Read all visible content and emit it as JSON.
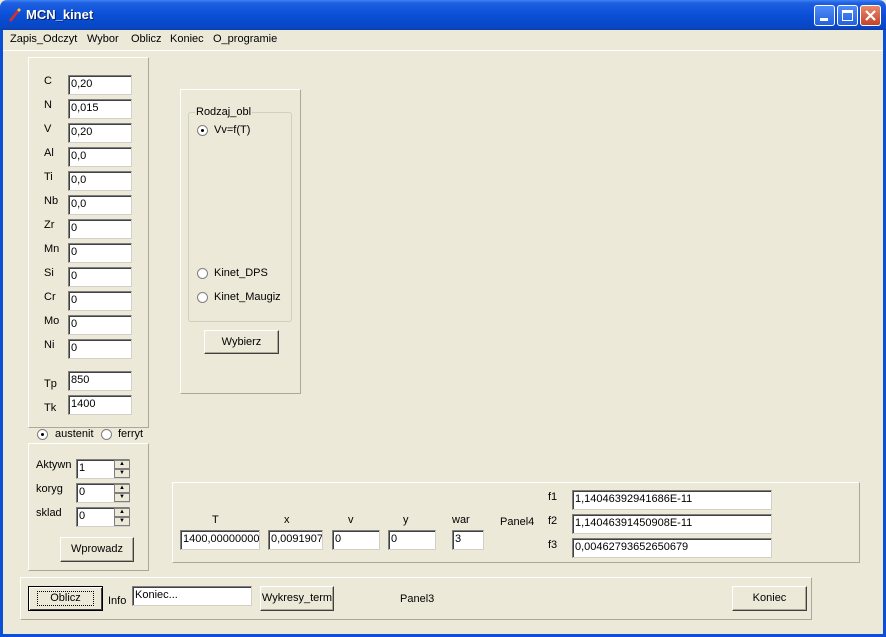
{
  "window": {
    "title": "MCN_kinet"
  },
  "menu": [
    "Zapis_Odczyt",
    "Wybor",
    "Oblicz",
    "Koniec",
    "O_programie"
  ],
  "composition": [
    {
      "label": "C",
      "value": "0,20"
    },
    {
      "label": "N",
      "value": "0,015"
    },
    {
      "label": "V",
      "value": "0,20"
    },
    {
      "label": "Al",
      "value": "0,0"
    },
    {
      "label": "Ti",
      "value": "0,0"
    },
    {
      "label": "Nb",
      "value": "0,0"
    },
    {
      "label": "Zr",
      "value": "0"
    },
    {
      "label": "Mn",
      "value": "0"
    },
    {
      "label": "Si",
      "value": "0"
    },
    {
      "label": "Cr",
      "value": "0"
    },
    {
      "label": "Mo",
      "value": "0"
    },
    {
      "label": "Ni",
      "value": "0"
    }
  ],
  "temps": [
    {
      "label": "Tp",
      "value": "850"
    },
    {
      "label": "Tk",
      "value": "1400"
    }
  ],
  "phase": {
    "austenit": "austenit",
    "ferryt": "ferryt",
    "selected": "austenit"
  },
  "spinners": [
    {
      "label": "Aktywn",
      "value": "1"
    },
    {
      "label": "koryg",
      "value": "0"
    },
    {
      "label": "sklad",
      "value": "0"
    }
  ],
  "wprowadz_label": "Wprowadz",
  "rodzaj": {
    "title": "Rodzaj_obl",
    "options": [
      "Vv=f(T)",
      "Kinet_DPS",
      "Kinet_Maugiz"
    ],
    "selected": "Vv=f(T)",
    "button": "Wybierz"
  },
  "results": {
    "headers": [
      "T",
      "x",
      "v",
      "y",
      "war"
    ],
    "values": [
      "1400,00000000",
      "0,0091907",
      "0",
      "0",
      "3"
    ],
    "panel_label": "Panel4",
    "f_labels": [
      "f1",
      "f2",
      "f3"
    ],
    "f_values": [
      "1,14046392941686E-11",
      "1,14046391450908E-11",
      "0,00462793652650679"
    ]
  },
  "bottom": {
    "oblicz": "Oblicz",
    "info_label": "Info",
    "info_value": "Koniec...",
    "wykresy": "Wykresy_term",
    "panel_label": "Panel3",
    "koniec": "Koniec"
  }
}
